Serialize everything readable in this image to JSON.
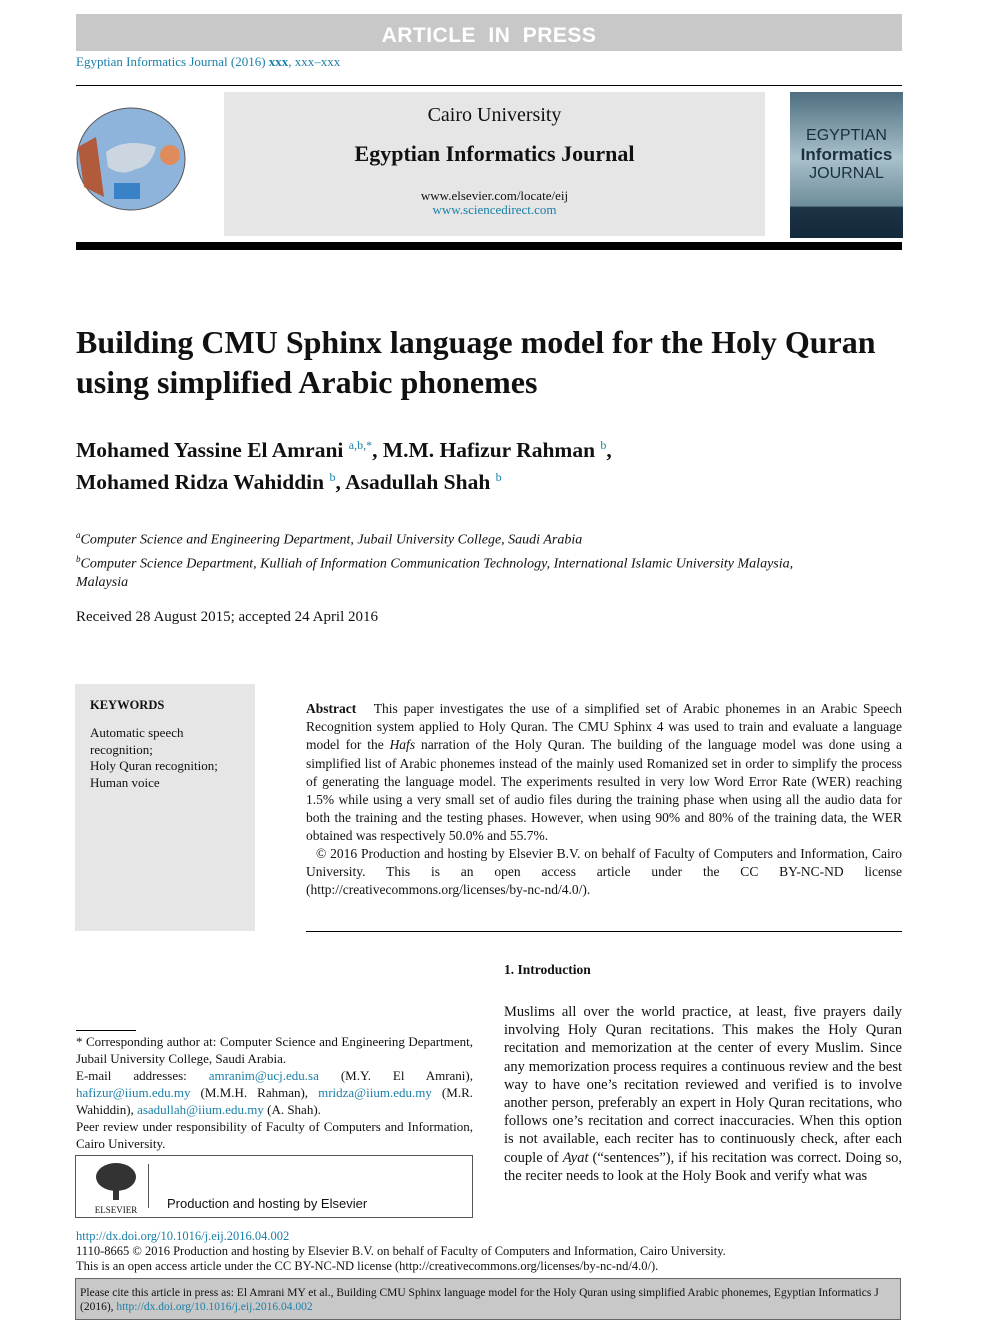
{
  "banner": "ARTICLE IN PRESS",
  "journal_citation": {
    "prefix": "Egyptian Informatics Journal (2016) ",
    "vol": "xxx",
    "pages": ", xxx–xxx"
  },
  "header": {
    "university": "Cairo University",
    "journal": "Egyptian Informatics Journal",
    "url1": "www.elsevier.com/locate/eij",
    "url2": "www.sciencedirect.com"
  },
  "cover": {
    "line1": "EGYPTIAN",
    "line2": "Informatics",
    "line3": "JOURNAL"
  },
  "title": "Building CMU Sphinx language model for the Holy Quran using simplified Arabic phonemes",
  "authors": [
    {
      "name": "Mohamed Yassine El Amrani",
      "sup": "a,b,*",
      "sep": ", "
    },
    {
      "name": "M.M. Hafizur Rahman",
      "sup": "b",
      "sep": ","
    },
    {
      "name": "Mohamed Ridza Wahiddin",
      "sup": "b",
      "sep": ", "
    },
    {
      "name": "Asadullah Shah",
      "sup": "b",
      "sep": ""
    }
  ],
  "affiliations": [
    {
      "sup": "a",
      "text": "Computer Science and Engineering Department, Jubail University College, Saudi Arabia"
    },
    {
      "sup": "b",
      "text": "Computer Science Department, Kulliah of Information Communication Technology, International Islamic University Malaysia, Malaysia"
    }
  ],
  "received": "Received 28 August 2015; accepted 24 April 2016",
  "keywords": {
    "heading": "KEYWORDS",
    "items": [
      "Automatic speech recognition;",
      "Holy Quran recognition;",
      "Human voice"
    ]
  },
  "abstract": {
    "label": "Abstract",
    "text_before": "This paper investigates the use of a simplified set of Arabic phonemes in an Arabic Speech Recognition system applied to Holy Quran. The CMU Sphinx 4 was used to train and evaluate a language model for the ",
    "italic": "Hafs",
    "text_after": " narration of the Holy Quran. The building of the language model was done using a simplified list of Arabic phonemes instead of the mainly used Romanized set in order to simplify the process of generating the language model. The experiments resulted in very low Word Error Rate (WER) reaching 1.5% while using a very small set of audio files during the training phase when using all the audio data for both the training and the testing phases. However, when using 90% and 80% of the training data, the WER obtained was respectively 50.0% and 55.7%.",
    "copyright": "© 2016 Production and hosting by Elsevier B.V. on behalf of Faculty of Computers and Information, Cairo University. This is an open access article under the CC BY-NC-ND license (http://creativecommons.org/licenses/by-nc-nd/4.0/)."
  },
  "intro": {
    "heading": "1. Introduction",
    "before": "Muslims all over the world practice, at least, five prayers daily involving Holy Quran recitations. This makes the Holy Quran recitation and memorization at the center of every Muslim. Since any memorization process requires a continuous review and the best way to have one’s recitation reviewed and verified is to involve another person, preferably an expert in Holy Quran recitations, who follows one’s recitation and correct inaccuracies. When this option is not available, each reciter has to continuously check, after each couple of ",
    "italic": "Ayat",
    "after": " (“sentences”), if his recitation was correct. Doing so, the reciter needs to look at the Holy Book and verify what was"
  },
  "footnote": {
    "corresponding": "* Corresponding author at: Computer Science and Engineering Department, Jubail University College, Saudi Arabia.",
    "email_label": "E-mail addresses: ",
    "emails": [
      {
        "email": "amranim@ucj.edu.sa",
        "who": " (M.Y. El Amrani), "
      },
      {
        "email": "hafizur@iium.edu.my",
        "who": " (M.M.H. Rahman), "
      },
      {
        "email": "mridza@iium.edu.my",
        "who": " (M.R. Wahiddin), "
      },
      {
        "email": "asadullah@iium.edu.my",
        "who": " (A. Shah)."
      }
    ],
    "peer": "Peer review under responsibility of Faculty of Computers and Information, Cairo University."
  },
  "elsevier": {
    "logo_text": "ELSEVIER",
    "label": "Production and hosting by Elsevier"
  },
  "bottom": {
    "doi": "http://dx.doi.org/10.1016/j.eij.2016.04.002",
    "line2": "1110-8665 © 2016 Production and hosting by Elsevier B.V. on behalf of Faculty of Computers and Information, Cairo University.",
    "line3": "This is an open access article under the CC BY-NC-ND license (http://creativecommons.org/licenses/by-nc-nd/4.0/)."
  },
  "cite": {
    "text": "Please cite this article in press as: El Amrani MY et al., Building CMU Sphinx language model for the Holy Quran using simplified Arabic phonemes, Egyptian Informatics J (2016), ",
    "doi": "http://dx.doi.org/10.1016/j.eij.2016.04.002"
  }
}
